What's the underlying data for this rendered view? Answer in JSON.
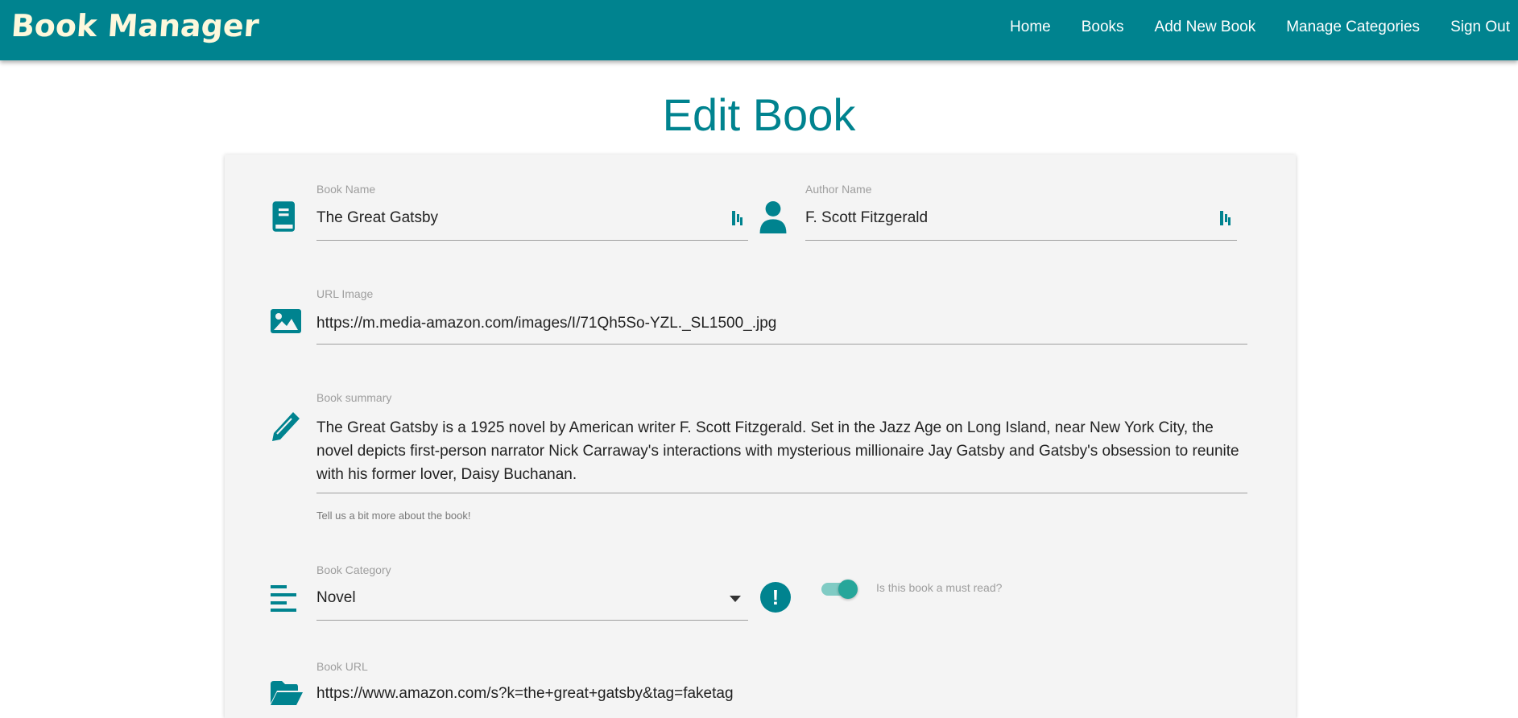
{
  "navbar": {
    "brand": "Book Manager",
    "links": [
      "Home",
      "Books",
      "Add New Book",
      "Manage Categories",
      "Sign Out"
    ]
  },
  "page_title": "Edit Book",
  "form": {
    "book_name": {
      "label": "Book Name",
      "value": "The Great Gatsby"
    },
    "author_name": {
      "label": "Author Name",
      "value": "F. Scott Fitzgerald"
    },
    "url_image": {
      "label": "URL Image",
      "value": "https://m.media-amazon.com/images/I/71Qh5So-YZL._SL1500_.jpg"
    },
    "summary": {
      "label": "Book summary",
      "value": "The Great Gatsby is a 1925 novel by American writer F. Scott Fitzgerald. Set in the Jazz Age on Long Island, near New York City, the novel depicts first-person narrator Nick Carraway's interactions with mysterious millionaire Jay Gatsby and Gatsby's obsession to reunite with his former lover, Daisy Buchanan.",
      "helper": "Tell us a bit more about the book!"
    },
    "category": {
      "label": "Book Category",
      "value": "Novel"
    },
    "must_read": {
      "label": "Is this book a must read?",
      "checked": true
    },
    "book_url": {
      "label": "Book URL",
      "value": "https://www.amazon.com/s?k=the+great+gatsby&tag=faketag"
    }
  },
  "colors": {
    "primary": "#00838f",
    "toggle": "#26a69a",
    "card": "#f4f4f4"
  }
}
